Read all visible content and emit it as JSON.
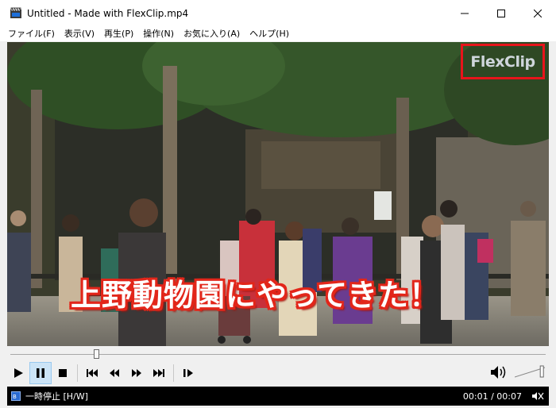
{
  "window": {
    "title": "Untitled - Made with FlexClip.mp4",
    "minimize_icon": "minimize-icon",
    "maximize_icon": "maximize-icon",
    "close_icon": "close-icon"
  },
  "menu": {
    "items": [
      {
        "label": "ファイル(F)"
      },
      {
        "label": "表示(V)"
      },
      {
        "label": "再生(P)"
      },
      {
        "label": "操作(N)"
      },
      {
        "label": "お気に入り(A)"
      },
      {
        "label": "ヘルプ(H)"
      }
    ]
  },
  "video": {
    "watermark": "FlexClip",
    "subtitle": "上野動物園にやってきた！",
    "colors": {
      "highlight_box": "#e8141b",
      "subtitle_outline": "#e2261a"
    }
  },
  "seek": {
    "progress": 0.16
  },
  "controls": {
    "buttons": [
      "play-icon",
      "pause-icon",
      "stop-icon",
      "skip-previous-icon",
      "rewind-icon",
      "fast-forward-icon",
      "skip-next-icon",
      "frame-step-icon"
    ],
    "active": "pause-icon",
    "volume": 0.9
  },
  "status": {
    "state": "一時停止 [H/W]",
    "time": "00:01 / 00:07"
  }
}
